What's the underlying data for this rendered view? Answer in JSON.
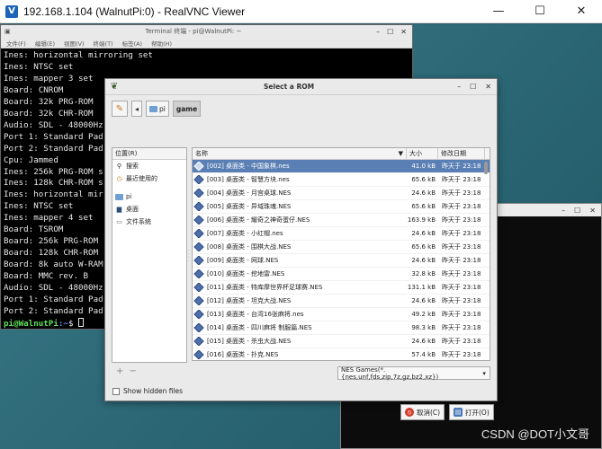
{
  "window": {
    "title": "192.168.1.104 (WalnutPi:0) - RealVNC Viewer",
    "minimize": "—",
    "maximize": "☐",
    "close": "✕"
  },
  "terminal": {
    "title": "Terminal 终端 - pi@WalnutPi: ~",
    "menu": [
      "文件(F)",
      "编辑(E)",
      "视图(V)",
      "终端(T)",
      "标签(A)",
      "帮助(H)"
    ],
    "lines": [
      "Ines: horizontal mirroring set",
      "Ines: NTSC set",
      "Ines: mapper 3 set",
      "Board: CNROM",
      "Board: 32k PRG-ROM",
      "Board: 32k CHR-ROM",
      "Audio: SDL - 48000Hz",
      "Port 1: Standard Pad",
      "Port 2: Standard Pad",
      "Cpu: Jammed",
      "Ines: 256k PRG-ROM s",
      "Ines: 128k CHR-ROM s",
      "Ines: horizontal mir",
      "Ines: NTSC set",
      "Ines: mapper 4 set",
      "Board: TSROM",
      "Board: 256k PRG-ROM",
      "Board: 128k CHR-ROM",
      "Board: 8k auto W-RAM",
      "Board: MMC rev. B",
      "Audio: SDL - 48000Hz",
      "Port 1: Standard Pad",
      "Port 2: Standard Pad"
    ],
    "prompt_user": "pi@WalnutPi",
    "prompt_path": ":~",
    "prompt_symbol": "$"
  },
  "dialog": {
    "title": "Select a ROM",
    "breadcrumbs": [
      "pi",
      "game"
    ],
    "places_header": "位置(R)",
    "places": [
      {
        "icon": "search-icon",
        "label": "搜索"
      },
      {
        "icon": "recent-icon",
        "label": "最近使用的"
      },
      {
        "icon": "folder-icon",
        "label": "pi"
      },
      {
        "icon": "desktop-icon",
        "label": "桌面"
      },
      {
        "icon": "filesystem-icon",
        "label": "文件系统"
      }
    ],
    "columns": {
      "name": "名称",
      "size": "大小",
      "date": "修改日期"
    },
    "files": [
      {
        "name": "[002] 桌面类 - 中国象棋.nes",
        "size": "41.0 kB",
        "date": "昨天于 23:18"
      },
      {
        "name": "[003] 桌面类 - 智慧方块.nes",
        "size": "65.6 kB",
        "date": "昨天于 23:18"
      },
      {
        "name": "[004] 桌面类 - 月宫桌球.NES",
        "size": "24.6 kB",
        "date": "昨天于 23:18"
      },
      {
        "name": "[005] 桌面类 - 异域珠魂.NES",
        "size": "65.6 kB",
        "date": "昨天于 23:18"
      },
      {
        "name": "[006] 桌面类 - 耀奇之神奇蛋仔.NES",
        "size": "163.9 kB",
        "date": "昨天于 23:18"
      },
      {
        "name": "[007] 桌面类 - 小红帽.nes",
        "size": "24.6 kB",
        "date": "昨天于 23:18"
      },
      {
        "name": "[008] 桌面类 - 围棋大战.NES",
        "size": "65.6 kB",
        "date": "昨天于 23:18"
      },
      {
        "name": "[009] 桌面类 - 网球.NES",
        "size": "24.6 kB",
        "date": "昨天于 23:18"
      },
      {
        "name": "[010] 桌面类 - 挖地雷.NES",
        "size": "32.8 kB",
        "date": "昨天于 23:18"
      },
      {
        "name": "[011] 桌面类 - 特库摩世界杯足球赛.NES",
        "size": "131.1 kB",
        "date": "昨天于 23:18"
      },
      {
        "name": "[012] 桌面类 - 坦克大战.NES",
        "size": "24.6 kB",
        "date": "昨天于 23:18"
      },
      {
        "name": "[013] 桌面类 - 台湾16张麻将.nes",
        "size": "49.2 kB",
        "date": "昨天于 23:18"
      },
      {
        "name": "[014] 桌面类 - 四川麻将 制服篇.NES",
        "size": "98.3 kB",
        "date": "昨天于 23:18"
      },
      {
        "name": "[015] 桌面类 - 杀虫大战.NES",
        "size": "24.6 kB",
        "date": "昨天于 23:18"
      },
      {
        "name": "[016] 桌面类 - 扑克.NES",
        "size": "57.4 kB",
        "date": "昨天于 23:18"
      }
    ],
    "filter": "NES Games(*.{nes,unf,fds,zip,7z,gz,bz2,xz})",
    "show_hidden": "Show hidden files",
    "cancel": "取消(C)",
    "open": "打开(O)"
  },
  "watermark": "CSDN @DOT小文哥",
  "colors": {
    "selection": "#5a7fb5",
    "prompt_user": "#5ee35e",
    "prompt_path": "#6a8cff"
  }
}
